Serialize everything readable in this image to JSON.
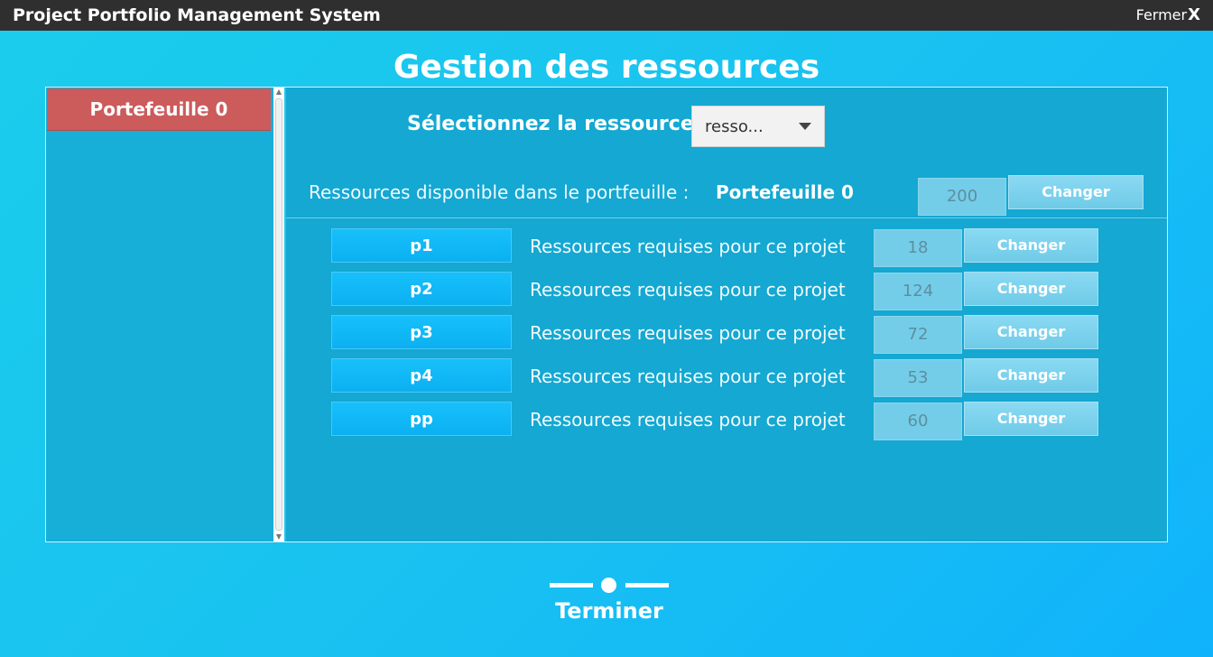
{
  "window": {
    "title": "Project Portfolio Management System",
    "close_label": "Fermer",
    "close_glyph": "X"
  },
  "page": {
    "title": "Gestion des ressources"
  },
  "sidebar": {
    "portfolios": [
      "Portefeuille 0"
    ]
  },
  "resource_select": {
    "label": "Sélectionnez la ressource",
    "value": "resso..."
  },
  "available": {
    "label": "Ressources disponible dans le portfeuille :",
    "portfolio": "Portefeuille 0",
    "value": "200",
    "button": "Changer"
  },
  "projects": [
    {
      "name": "p1",
      "label": "Ressources requises pour ce projet",
      "value": "18",
      "button": "Changer"
    },
    {
      "name": "p2",
      "label": "Ressources requises pour ce projet",
      "value": "124",
      "button": "Changer"
    },
    {
      "name": "p3",
      "label": "Ressources requises pour ce projet",
      "value": "72",
      "button": "Changer"
    },
    {
      "name": "p4",
      "label": "Ressources requises pour ce projet",
      "value": "53",
      "button": "Changer"
    },
    {
      "name": "pp",
      "label": "Ressources requises pour ce projet",
      "value": "60",
      "button": "Changer"
    }
  ],
  "footer": {
    "finish_label": "Terminer",
    "finish_icon": "progress-slider-icon"
  }
}
